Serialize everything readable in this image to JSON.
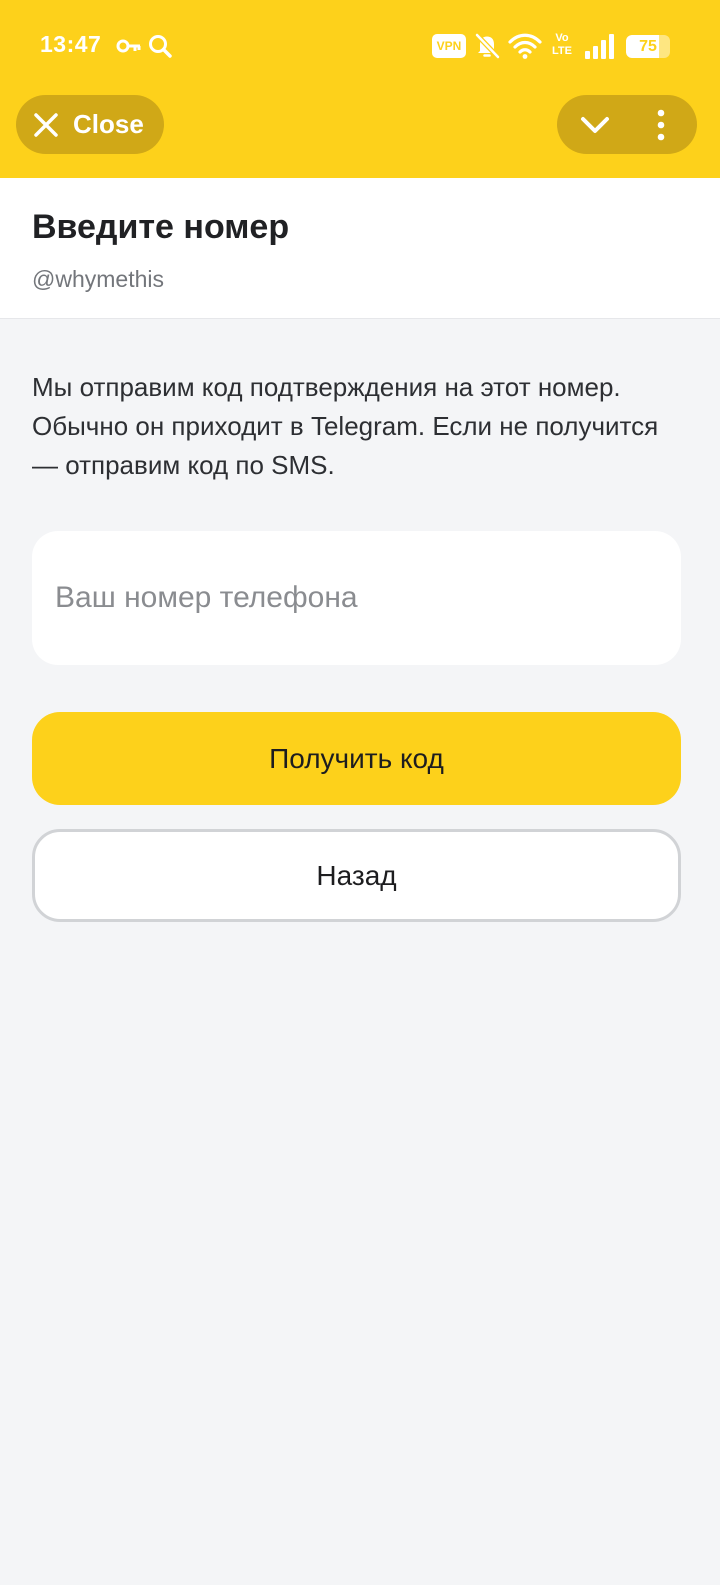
{
  "status_bar": {
    "time": "13:47",
    "vpn_label": "VPN",
    "lte_label": "Vo\nLTE",
    "battery_level": "75",
    "battery_fraction": 0.75,
    "icons": [
      "key-icon",
      "search-icon",
      "vpn-icon",
      "mute-bell-icon",
      "wifi-icon",
      "volte-icon",
      "signal-icon",
      "battery-icon"
    ]
  },
  "app_bar": {
    "close_label": "Close",
    "accent_color": "#fdd11b",
    "pill_color": "#d0a817",
    "icons": [
      "close-icon",
      "chevron-down-icon",
      "more-vertical-icon"
    ]
  },
  "header": {
    "title": "Введите номер",
    "username": "@whymethis"
  },
  "main": {
    "description": "Мы отправим код подтверждения на этот номер. Обычно он приходит в Telegram. Если не получится — отправим код по SMS.",
    "phone_input": {
      "placeholder": "Ваш номер телефона",
      "value": ""
    },
    "primary_button_label": "Получить код",
    "secondary_button_label": "Назад"
  }
}
